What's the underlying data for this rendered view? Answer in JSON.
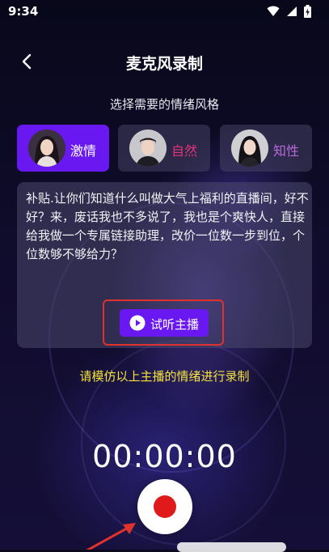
{
  "status_bar": {
    "time": "9:34",
    "icons": [
      "wifi-icon",
      "cellular-signal-icon",
      "battery-charging-icon"
    ]
  },
  "header": {
    "back_icon": "chevron-left-icon",
    "title": "麦克风录制"
  },
  "subtitle": "选择需要的情绪风格",
  "emotion_tabs": [
    {
      "label": "激情",
      "active": true,
      "label_color": "#ffffff"
    },
    {
      "label": "自然",
      "active": false,
      "label_color": "#e0337a"
    },
    {
      "label": "知性",
      "active": false,
      "label_color": "#b86ad8"
    }
  ],
  "script_card": {
    "text": "补贴.让你们知道什么叫做大气上福利的直播间，好不好？来，废话我也不多说了，我也是个爽快人，直接给我做一个专属链接助理，改价一位数一步到位，个位数够不够给力？",
    "play_button_label": "试听主播",
    "play_icon": "play-circle-icon"
  },
  "hint": "请模仿以上主播的情绪进行录制",
  "timer": "00:00:00",
  "record_button": {
    "icon": "record-dot-icon"
  },
  "colors": {
    "accent": "#6a18f2",
    "highlight": "#e0322c",
    "hint": "#f4e23a",
    "record": "#e01a1a"
  }
}
